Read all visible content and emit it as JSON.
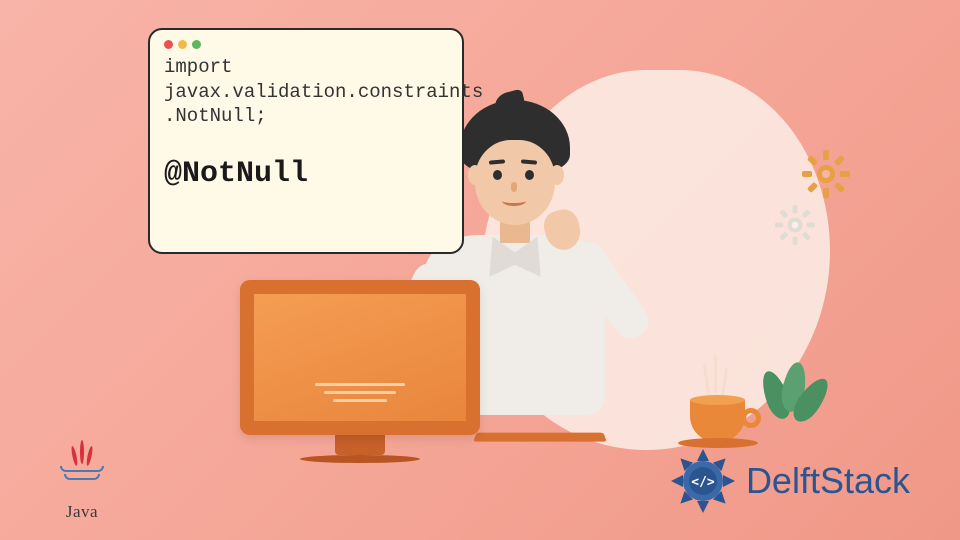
{
  "code_card": {
    "line1": "import",
    "line2": "javax.validation.constraints",
    "line3": ".NotNull;",
    "annotation": "@NotNull"
  },
  "logos": {
    "java_label": "Java",
    "delftstack_label": "DelftStack"
  },
  "icons": {
    "traffic_red": "red-dot-icon",
    "traffic_yellow": "yellow-dot-icon",
    "traffic_green": "green-dot-icon",
    "gear": "gear-icon",
    "cup": "coffee-cup-icon",
    "monitor": "monitor-icon",
    "person": "developer-illustration",
    "plant": "plant-icon"
  },
  "colors": {
    "bg_start": "#f8b4a8",
    "bg_end": "#f09888",
    "card_bg": "#fff9e8",
    "card_border": "#2a2a2a",
    "gear_orange": "#e8a044",
    "gear_gray": "#d8d4cc",
    "delft_blue": "#2a5590",
    "java_red": "#d8303c",
    "java_blue": "#4a7ab0"
  }
}
